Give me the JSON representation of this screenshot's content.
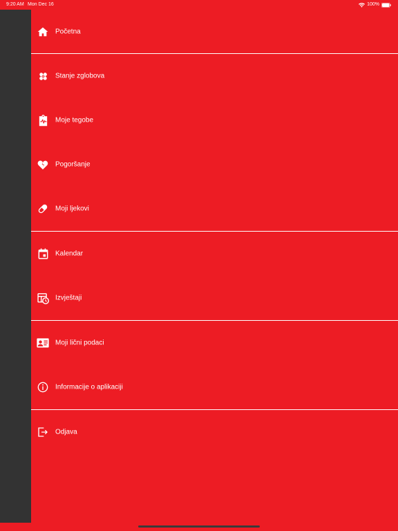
{
  "status_bar": {
    "time": "9:20 AM",
    "date": "Mon Dec 16",
    "battery": "100%"
  },
  "colors": {
    "background": "#ED1C24",
    "sidebar_strip": "#333333",
    "divider": "#FFFFFF"
  },
  "menu": {
    "items": [
      {
        "label": "Početna",
        "icon": "home-icon"
      },
      {
        "label": "Stanje zglobova",
        "icon": "bandage-icon"
      },
      {
        "label": "Moje tegobe",
        "icon": "clipboard-pulse-icon"
      },
      {
        "label": "Pogoršanje",
        "icon": "broken-heart-icon"
      },
      {
        "label": "Moji ljekovi",
        "icon": "pill-icon"
      },
      {
        "label": "Kalendar",
        "icon": "calendar-icon"
      },
      {
        "label": "Izvještaji",
        "icon": "report-clock-icon"
      },
      {
        "label": "Moji lični podaci",
        "icon": "id-card-icon"
      },
      {
        "label": "Informacije o aplikaciji",
        "icon": "info-icon"
      },
      {
        "label": "Odjava",
        "icon": "logout-icon"
      }
    ]
  }
}
